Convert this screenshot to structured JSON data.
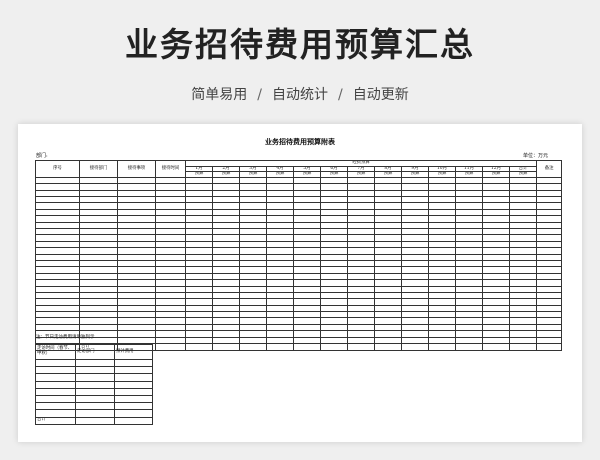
{
  "hero": {
    "title": "业务招待费用预算汇总",
    "subtitle_items": [
      "简单易用",
      "自动统计",
      "自动更新"
    ],
    "separator": "/"
  },
  "document": {
    "title": "业务招待费用预算附表",
    "department_label": "部门:",
    "unit_label": "单位：万元",
    "main_table": {
      "col_seq": "序号",
      "col_dept": "接待部门",
      "col_matter": "接待事项",
      "col_time": "接待时间",
      "group_header": "经费预算",
      "months": [
        "1月",
        "2月",
        "3月",
        "4月",
        "5月",
        "6月",
        "7月",
        "8月",
        "9月",
        "10月",
        "11月",
        "12月",
        "合计"
      ],
      "budget_label": "预算",
      "col_remark": "备注",
      "empty_rows": 26,
      "total_label": "合计"
    },
    "note": "注：节日走访费用请单独列示",
    "sub_table": {
      "col_visit_time": "走访时间（春节、中秋）",
      "col_visit_dept": "走访部门",
      "col_estimate": "预计费用",
      "empty_rows": 8,
      "total_label": "合计"
    }
  }
}
